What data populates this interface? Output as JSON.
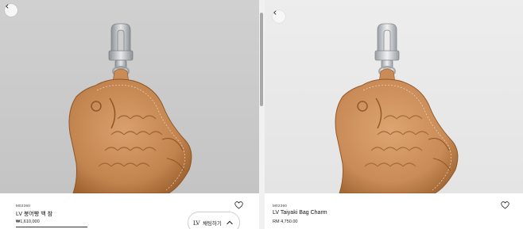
{
  "left_panel": {
    "sku": "M02360",
    "product_name": "LV 붕어빵 백 참",
    "price": "₩1,610,000",
    "chat_label": "채팅하기",
    "chat_brand": "LV"
  },
  "right_panel": {
    "sku": "M02360",
    "product_name": "LV Taiyaki Bag Charm",
    "price": "RM 4,750.00"
  },
  "icons": {
    "back": "chevron-left-icon",
    "wishlist": "heart-icon",
    "expand": "chevron-up-icon"
  },
  "colors": {
    "leather": "#c98b57",
    "leather_dark": "#9e6331",
    "metal": "#b8bcc0"
  }
}
